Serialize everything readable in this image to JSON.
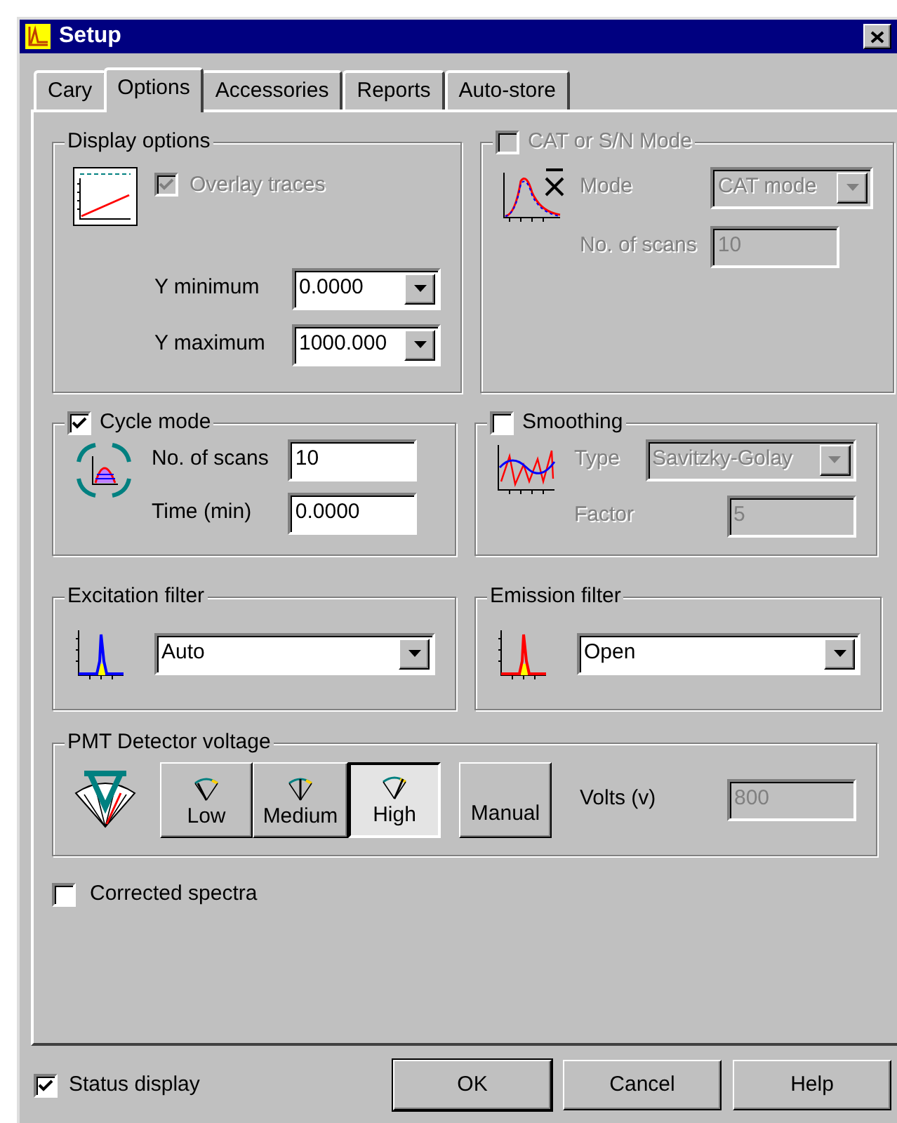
{
  "window": {
    "title": "Setup"
  },
  "tabs": [
    {
      "label": "Cary",
      "selected": false
    },
    {
      "label": "Options",
      "selected": true
    },
    {
      "label": "Accessories",
      "selected": false
    },
    {
      "label": "Reports",
      "selected": false
    },
    {
      "label": "Auto-store",
      "selected": false
    }
  ],
  "display_options": {
    "title": "Display options",
    "overlay_traces": {
      "label": "Overlay traces",
      "checked": true,
      "disabled": true
    },
    "y_minimum": {
      "label": "Y minimum",
      "value": "0.0000"
    },
    "y_maximum": {
      "label": "Y maximum",
      "value": "1000.000"
    }
  },
  "cat_mode": {
    "title": "CAT or S/N Mode",
    "checked": false,
    "disabled": true,
    "mode": {
      "label": "Mode",
      "value": "CAT mode"
    },
    "scans": {
      "label": "No. of scans",
      "value": "10"
    }
  },
  "cycle_mode": {
    "title": "Cycle mode",
    "checked": true,
    "disabled": false,
    "scans": {
      "label": "No. of scans",
      "value": "10"
    },
    "time": {
      "label": "Time (min)",
      "value": "0.0000"
    }
  },
  "smoothing": {
    "title": "Smoothing",
    "checked": false,
    "disabled": false,
    "type": {
      "label": "Type",
      "value": "Savitzky-Golay",
      "disabled": true
    },
    "factor": {
      "label": "Factor",
      "value": "5",
      "disabled": true
    }
  },
  "excitation_filter": {
    "title": "Excitation filter",
    "value": "Auto"
  },
  "emission_filter": {
    "title": "Emission filter",
    "value": "Open"
  },
  "pmt_detector_voltage": {
    "title": "PMT Detector voltage",
    "buttons": [
      {
        "label": "Low",
        "selected": false
      },
      {
        "label": "Medium",
        "selected": false
      },
      {
        "label": "High",
        "selected": true
      }
    ],
    "manual_button": "Manual",
    "volts": {
      "label": "Volts (v)",
      "value": "800",
      "disabled": true
    }
  },
  "corrected_spectra": {
    "label": "Corrected spectra",
    "checked": false
  },
  "status_display": {
    "label": "Status display",
    "checked": true
  },
  "buttons": [
    {
      "label": "OK",
      "default": true
    },
    {
      "label": "Cancel",
      "default": false
    },
    {
      "label": "Help",
      "default": false
    }
  ]
}
